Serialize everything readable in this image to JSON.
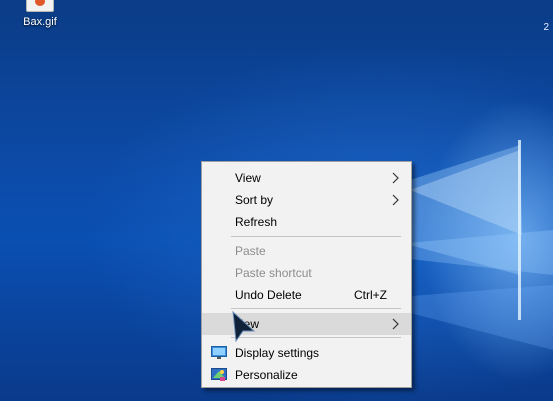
{
  "desktop": {
    "icon_label": "Bax.gif",
    "corner_text": "2"
  },
  "menu": {
    "view": "View",
    "sort_by": "Sort by",
    "refresh": "Refresh",
    "paste": "Paste",
    "paste_shortcut": "Paste shortcut",
    "undo_delete": "Undo Delete",
    "undo_shortcut": "Ctrl+Z",
    "new": "New",
    "display_settings": "Display settings",
    "personalize": "Personalize"
  },
  "icons": {
    "submenu": "chevron-right-icon",
    "display": "display-settings-icon",
    "personalize": "personalize-icon",
    "cursor": "mouse-cursor-icon"
  },
  "colors": {
    "menu_bg": "#f2f2f2",
    "hover_bg": "#dadada",
    "disabled_text": "#8d8d8d"
  }
}
